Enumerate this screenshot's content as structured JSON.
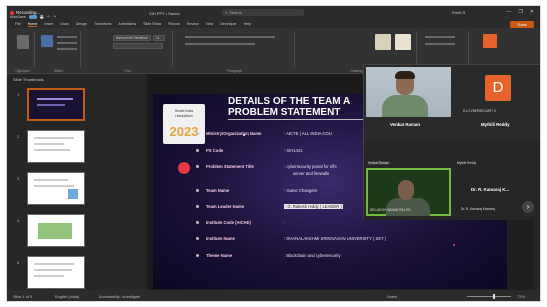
{
  "window": {
    "recording_label": "Recording...",
    "autosave_label": "AutoSave",
    "file_name": "SIH PPT • Saved",
    "search_placeholder": "Search",
    "user_label": "Rohit R",
    "controls": [
      "—",
      "❐",
      "✕"
    ]
  },
  "ribbon": {
    "tabs": [
      "File",
      "Home",
      "Insert",
      "Draw",
      "Design",
      "Transitions",
      "Animations",
      "Slide Show",
      "Record",
      "Review",
      "View",
      "Developer",
      "Help"
    ],
    "active_tab": "Home",
    "share_label": "Share",
    "groups": [
      "Clipboard",
      "Slides",
      "Font",
      "Paragraph",
      "Drawing",
      "Editing",
      "Add-ins"
    ],
    "font_name": "Bahnschrift SemiBold",
    "font_size": "11"
  },
  "thumbnails": {
    "pane_title": "Slide Thumbnails",
    "numbers": [
      "1",
      "2",
      "3",
      "4",
      "5"
    ],
    "active_index": 1
  },
  "slide": {
    "logo_line1": "Smart India",
    "logo_line2": "Hackathon",
    "logo_year": "2023",
    "title_line1": "DETAILS OF THE TEAM A",
    "title_line2": "PROBLEM STATEMENT",
    "rows": [
      {
        "label": "Ministry/Organization Name",
        "value": ": AICTE ( ALL INDIA COU"
      },
      {
        "label": "PS Code",
        "value": ": SIH1441"
      },
      {
        "label": "Problem Statement Title",
        "value": ": cybersecurity portal for effe"
      },
      {
        "label": "",
        "value": "server and firewalls"
      },
      {
        "label": "Team Name",
        "value": ": Game Changers"
      },
      {
        "label": "Team Leader Name",
        "value": ": G. Rakesh reddy ( LEADER )"
      },
      {
        "label": "Institute Code (AICHE)",
        "value": ":"
      },
      {
        "label": "Institute Name",
        "value": ": DHANALAKSHMI SRINIVASAN UNIVERSITY ( SET )"
      },
      {
        "label": "Theme Name",
        "value": ": Blockchain and cybersecurity"
      }
    ]
  },
  "call": {
    "tiles": [
      {
        "name": "Venkat Raman",
        "sub": "Venkat Raman"
      },
      {
        "name": "Mythili Reddy",
        "sub": "Mythili Reddy",
        "avatar_letter": "D",
        "avatar_sub": "D1-CYBERSECURIT II"
      },
      {
        "name": "",
        "sub": "DR.LAKSH MANAN RAJ ER"
      },
      {
        "name": "Dr. R. Kamaraj K...",
        "sub": "Dr. R. Kamaraj Kamaraj"
      }
    ],
    "next_label": "›"
  },
  "statusbar": {
    "slide_info": "Slide 1 of 5",
    "language": "English (India)",
    "accessibility": "Accessibility: Investigate",
    "notes": "Notes",
    "zoom": "72%"
  },
  "colors": {
    "accent": "#c55a11",
    "slide_bg": "#1a1038",
    "recording": "#e53935",
    "active_speaker": "#6fba3f",
    "avatar_bg": "#e8632b"
  }
}
